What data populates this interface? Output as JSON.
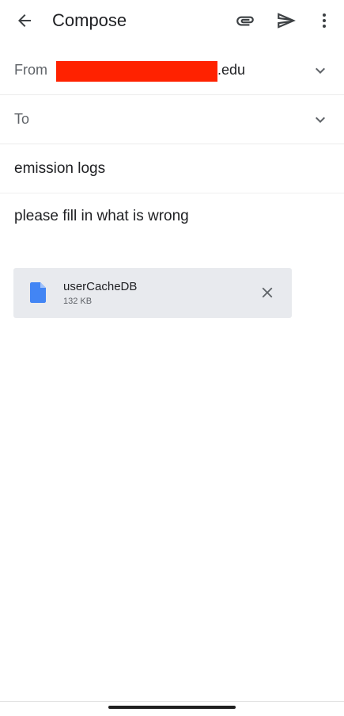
{
  "header": {
    "title": "Compose",
    "icons": {
      "back": "arrow-back-icon",
      "attach": "paperclip-icon",
      "send": "send-icon",
      "more": "more-vert-icon"
    }
  },
  "from": {
    "label": "From",
    "address_suffix": ".edu",
    "redacted": true
  },
  "to": {
    "label": "To",
    "value": ""
  },
  "subject": {
    "value": "emission logs"
  },
  "body": {
    "text": "please fill in what is wrong"
  },
  "attachment": {
    "name": "userCacheDB",
    "size": "132 KB",
    "icon": "file-icon",
    "file_icon_color": "#4285f4"
  },
  "colors": {
    "redaction": "#ff2200",
    "chip_bg": "#e8eaee"
  }
}
